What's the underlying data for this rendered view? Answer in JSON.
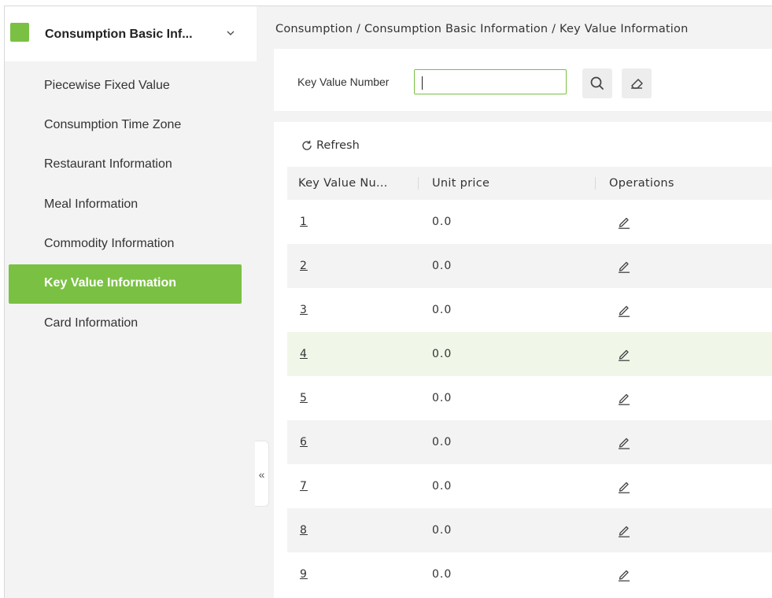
{
  "module": {
    "title": "Consumption Basic Inf...",
    "logo_color": "#7ac143"
  },
  "menu": {
    "items": [
      {
        "label": "Piecewise Fixed Value",
        "active": false
      },
      {
        "label": "Consumption Time Zone",
        "active": false
      },
      {
        "label": "Restaurant Information",
        "active": false
      },
      {
        "label": "Meal Information",
        "active": false
      },
      {
        "label": "Commodity Information",
        "active": false
      },
      {
        "label": "Key Value Information",
        "active": true
      },
      {
        "label": "Card Information",
        "active": false
      }
    ]
  },
  "sidebar_toggle": {
    "glyph": "«"
  },
  "breadcrumb": {
    "text": "Consumption / Consumption Basic Information / Key Value Information"
  },
  "search": {
    "label": "Key Value Number",
    "value": "",
    "placeholder": ""
  },
  "toolbar": {
    "refresh_label": "Refresh"
  },
  "table": {
    "columns": [
      "Key Value Nu...",
      "Unit price",
      "Operations"
    ],
    "rows": [
      {
        "key": "1",
        "unit_price": "0.0"
      },
      {
        "key": "2",
        "unit_price": "0.0"
      },
      {
        "key": "3",
        "unit_price": "0.0"
      },
      {
        "key": "4",
        "unit_price": "0.0"
      },
      {
        "key": "5",
        "unit_price": "0.0"
      },
      {
        "key": "6",
        "unit_price": "0.0"
      },
      {
        "key": "7",
        "unit_price": "0.0"
      },
      {
        "key": "8",
        "unit_price": "0.0"
      },
      {
        "key": "9",
        "unit_price": "0.0"
      }
    ]
  },
  "colors": {
    "accent": "#7ac143",
    "row_alt": "#f3f3f3",
    "row_hover": "#f0f7e9"
  },
  "icons": {
    "module": "module-logo-icon",
    "expand": "chevron-down-icon",
    "search": "search-icon",
    "clear": "eraser-icon",
    "refresh": "refresh-icon",
    "edit": "edit-icon",
    "collapse": "double-chevron-left-icon"
  }
}
